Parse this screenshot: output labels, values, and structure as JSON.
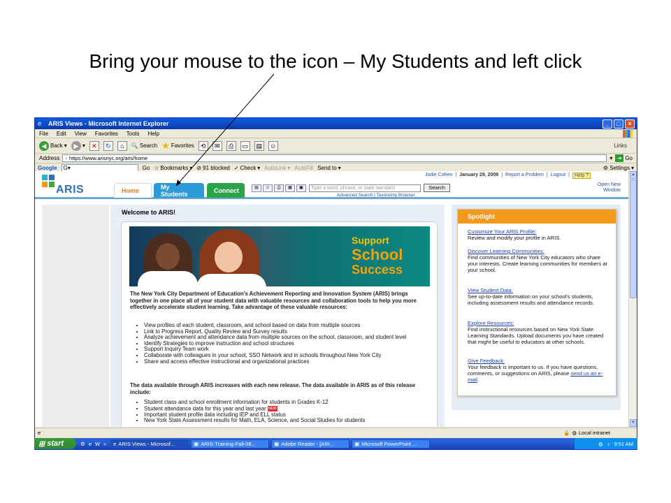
{
  "caption": "Bring your mouse to the icon – My Students and left click",
  "browser": {
    "title": "ARIS Views - Microsoft Internet Explorer",
    "menu": [
      "File",
      "Edit",
      "View",
      "Favorites",
      "Tools",
      "Help"
    ],
    "toolbar": {
      "back": "Back",
      "search": "Search",
      "favorites": "Favorites",
      "links": "Links"
    },
    "address_label": "Address",
    "address_value": "https://www.arisnyc.org/aris/home",
    "go_label": "Go",
    "google": {
      "logo": "Google",
      "go": "Go",
      "bookmarks": "Bookmarks",
      "blocked": "91 blocked",
      "check": "Check",
      "autolink": "AutoLink",
      "autofill": "AutoFill",
      "sendto": "Send to",
      "settings": "Settings"
    },
    "status": {
      "zone": "Local intranet"
    }
  },
  "aris": {
    "logo": "ARIS",
    "tabs": {
      "home": "Home",
      "mystudents": "My Students",
      "connect": "Connect"
    },
    "search_placeholder": "Type a word, phrase, or state standard",
    "search_button": "Search",
    "advanced": "Advanced Search | Taxonomy Browser",
    "user": "Jodie Cohen",
    "date": "January 29, 2009",
    "report": "Report a Problem",
    "logout": "Logout",
    "help": "Help",
    "open_new": "Open New",
    "open_window": "Window",
    "welcome": "Welcome to ARIS!",
    "banner": {
      "line1": "Support",
      "line2": "School",
      "line3": "Success"
    },
    "intro": "The New York City Department of Education's Achievement Reporting and Innovation System (ARIS) brings together in one place all of your student data with valuable resources and collaboration tools to help you more effectively accelerate student learning. Take advantage of these valuable resources:",
    "bullets": [
      "View profiles of each student, classroom, and school based on data from multiple sources",
      "Link to Progress Report, Quality Review and Survey results",
      "Analyze achievement and attendance data from multiple sources on the school, classroom, and student level",
      "Identify Strategies to improve instruction and school structures",
      "Support Inquiry Team work",
      "Collaborate with colleagues in your school, SSO Network and in schools throughout New York City",
      "Share and access effective instructional and organizational practices"
    ],
    "intro2": "The data available through ARIS increases with each new release. The data available in ARIS as of this release include:",
    "bullets2": [
      "Student class and school enrollment information for students in Grades K-12",
      "Student attendance data for this year and last year",
      "Important student profile data including IEP and ELL status",
      "New York State Assessment results for Math, ELA, Science, and Social Studies for students"
    ],
    "new_tag": "NEW",
    "spotlight": {
      "title": "Spotlight",
      "items": [
        {
          "link": "Customize Your ARIS Profile:",
          "text": "Review and modify your profile in ARIS."
        },
        {
          "link": "Discover Learning Communities:",
          "text": "Find communities of New York City educators who share your interests. Create learning communities for members at your school."
        },
        {
          "link": "View Student Data:",
          "text": "See up-to-date information on your school's students, including assessment results and attendance records."
        },
        {
          "link": "Explore Resources:",
          "text": "Find instructional resources based on New York State Learning Standards. Upload documents you have created that might be useful to educators at other schools."
        },
        {
          "link": "Give Feedback:",
          "text": "Your feedback is important to us. If you have questions, comments, or suggestions on ARIS, please",
          "tail_link": "send us an e-mail",
          "tail": "."
        }
      ]
    }
  },
  "taskbar": {
    "start": "start",
    "windows": [
      "ARIS Views - Microsof...",
      "ARIS-Training-Fall-08...",
      "Adobe Reader - [ARI...",
      "Microsoft PowerPoint ..."
    ],
    "time": "9:51 AM"
  }
}
